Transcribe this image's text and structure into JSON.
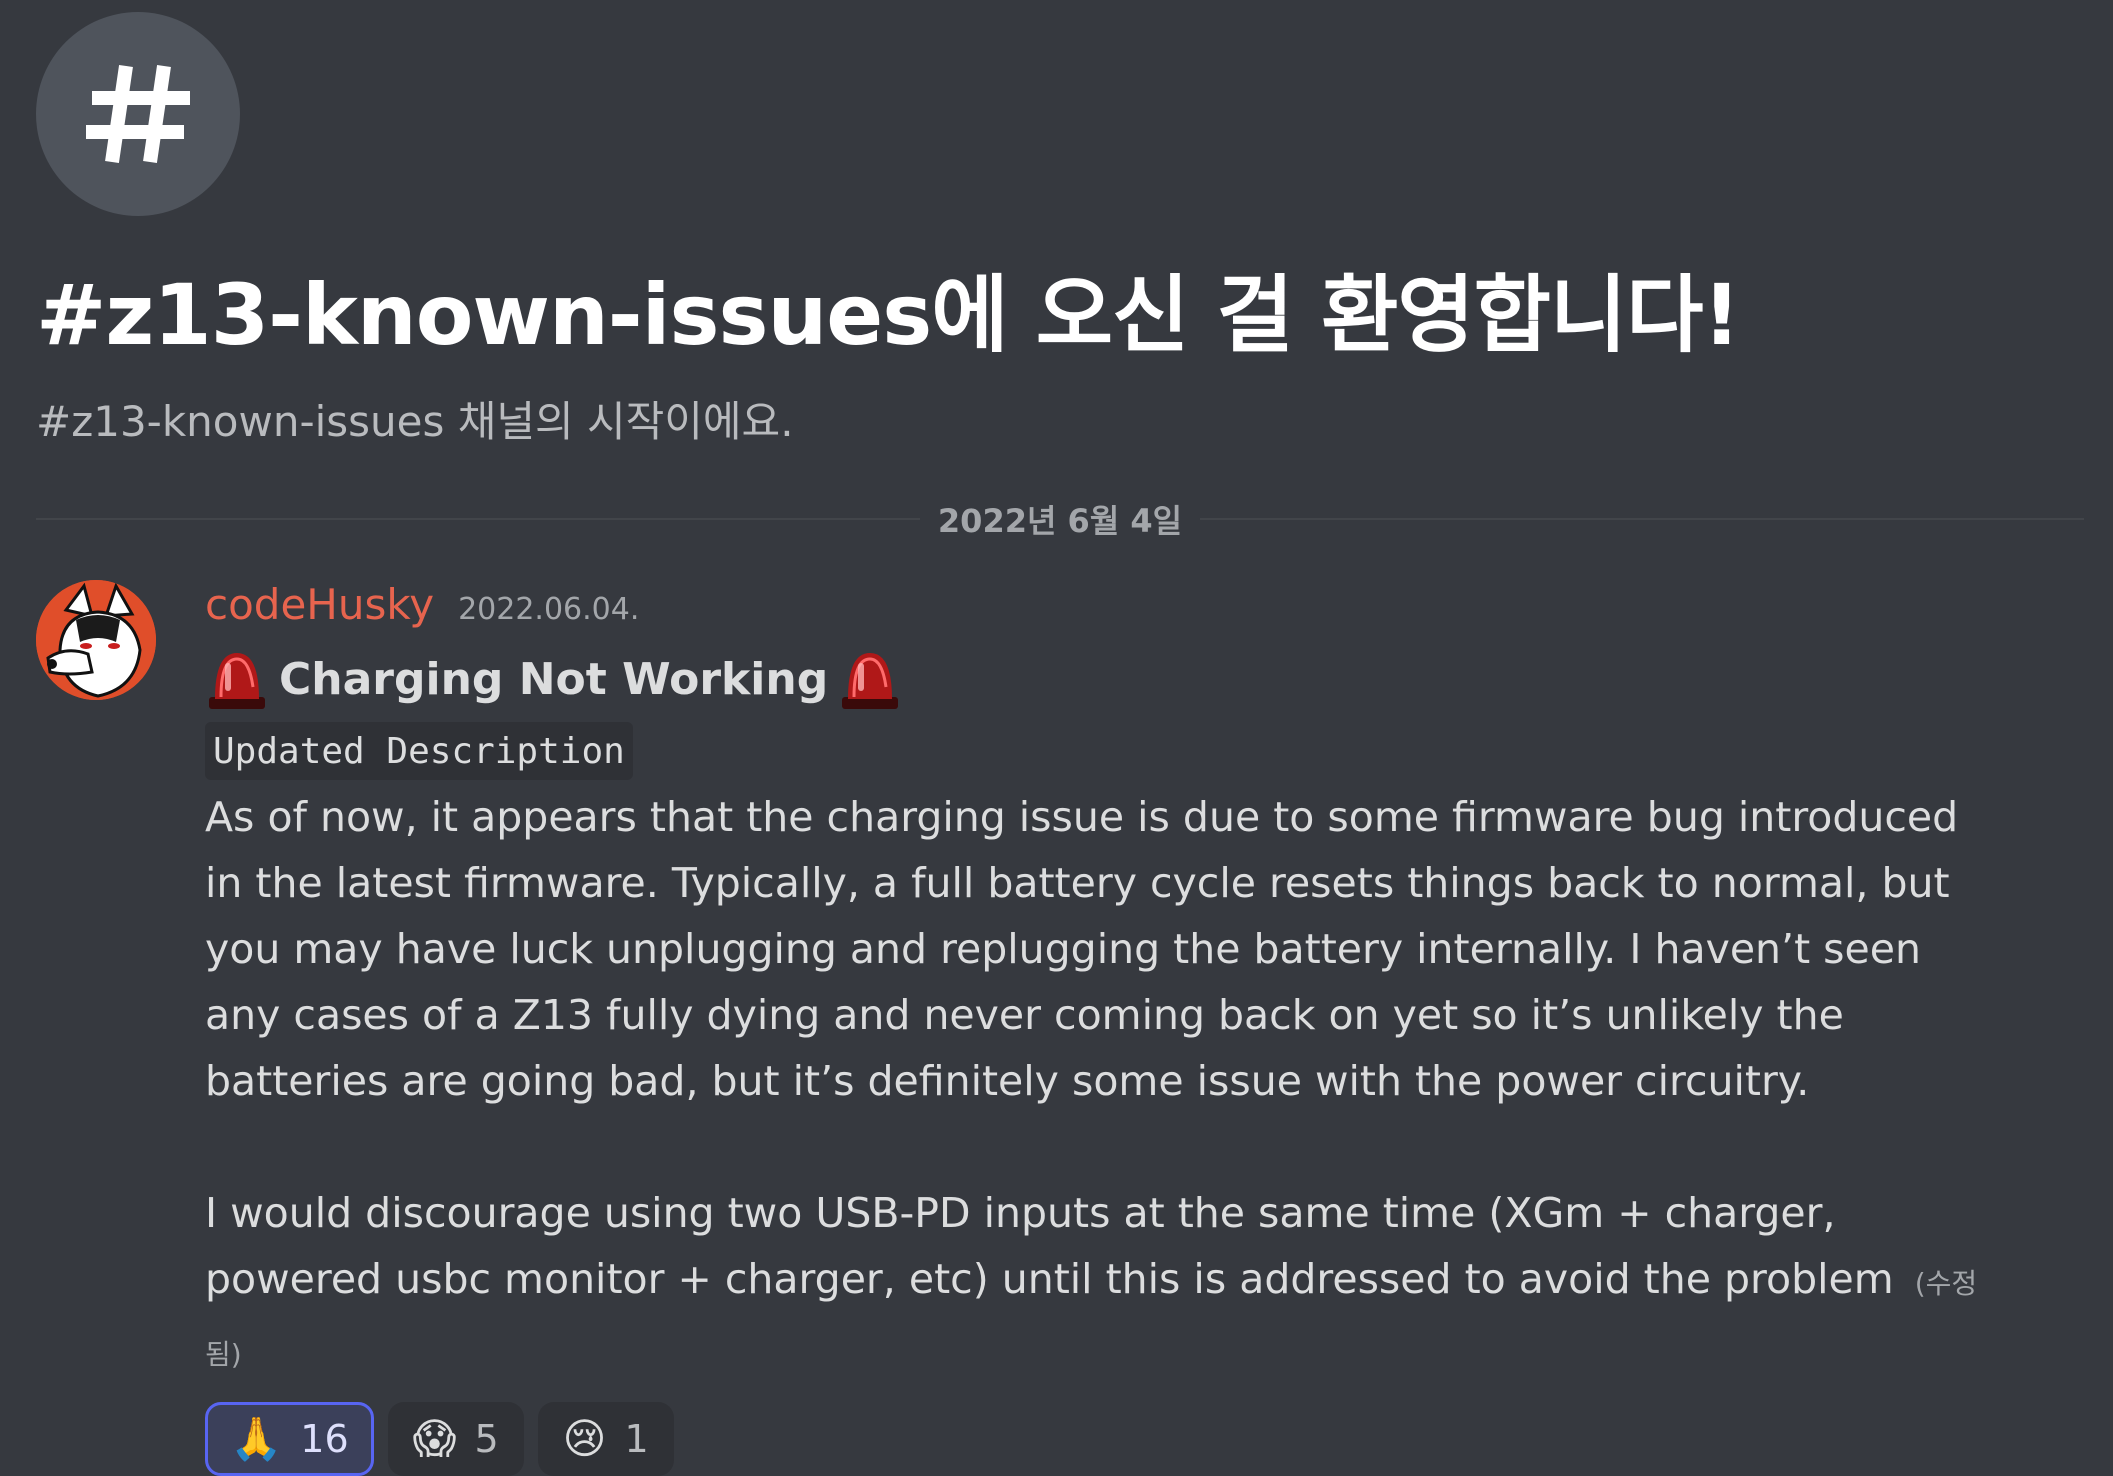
{
  "channel": {
    "icon": "hash-icon",
    "welcome_title": "#z13-known-issues에 오신 걸 환영합니다!",
    "welcome_subtitle": "#z13-known-issues 채널의 시작이에요."
  },
  "divider": {
    "date": "2022년 6월 4일"
  },
  "message": {
    "author": "codeHusky",
    "author_color": "#e7644e",
    "timestamp": "2022.06.04.",
    "heading": "Charging Not Working",
    "heading_icon": "rotating-light-icon",
    "code_label": "Updated Description",
    "paragraph1": "As of now, it appears that the charging issue is due to some firmware bug introduced in the latest firmware. Typically, a full battery cycle resets things back to normal, but you may have luck unplugging and replugging the battery internally. I haven’t seen any cases of a Z13 fully dying and never coming back on yet so it’s unlikely the batteries are going bad, but it’s definitely some issue with the power circuitry.",
    "paragraph2": "I would discourage using two USB-PD inputs at the same time (XGm + charger, powered usbc monitor + charger, etc) until this is addressed to avoid the problem",
    "edited_label": "(수정됨)"
  },
  "reactions": [
    {
      "emoji": "🙏",
      "icon": "folded-hands-icon",
      "count": "16",
      "active": true
    },
    {
      "emoji": "😱",
      "icon": "screaming-face-icon",
      "count": "5",
      "active": false
    },
    {
      "emoji": "😢",
      "icon": "crying-face-icon",
      "count": "1",
      "active": false
    }
  ],
  "colors": {
    "background": "#36393f",
    "accent": "#5865f2"
  }
}
